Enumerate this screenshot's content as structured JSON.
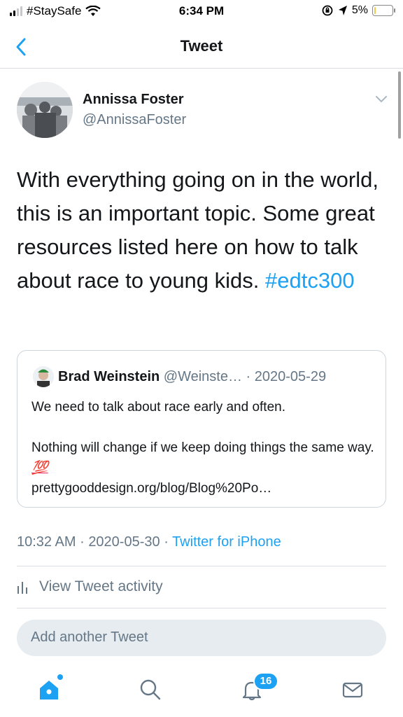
{
  "status_bar": {
    "carrier": "#StaySafe",
    "time": "6:34 PM",
    "battery_pct": "5%",
    "battery_level": 0.05,
    "icons": [
      "signal-icon",
      "wifi-icon",
      "orientation-lock-icon",
      "location-arrow-icon",
      "battery-icon"
    ]
  },
  "nav": {
    "title": "Tweet",
    "back_icon": "chevron-left-icon"
  },
  "tweet": {
    "author_name": "Annissa Foster",
    "author_handle": "@AnnissaFoster",
    "text": "With everything going on in the world, this is an important topic. Some great resources listed here on how to talk about race to young kids.",
    "hashtag": "#edtc300",
    "time": "10:32 AM",
    "date": "2020-05-30",
    "source": "Twitter for iPhone",
    "separator": "·",
    "menu_icon": "chevron-down-icon"
  },
  "quoted_tweet": {
    "author_name": "Brad Weinstein",
    "author_handle": "@Weinste…",
    "separator": "·",
    "date": "2020-05-29",
    "line1": "We need to talk about race early and often.",
    "line2": "Nothing will change if we keep doing things the same way.",
    "emoji": "💯",
    "link": "prettygooddesign.org/blog/Blog%20Po…"
  },
  "activity": {
    "label": "View Tweet activity",
    "icon": "bar-chart-icon"
  },
  "compose": {
    "placeholder": "Add another Tweet"
  },
  "tab_bar": {
    "notification_count": "16",
    "accent": "#1da1f2",
    "icons": [
      "home-icon",
      "search-icon",
      "bell-icon",
      "mail-icon"
    ]
  },
  "colors": {
    "accent": "#1da1f2",
    "text": "#14171a",
    "muted": "#657786",
    "border": "#ccd6dd"
  }
}
